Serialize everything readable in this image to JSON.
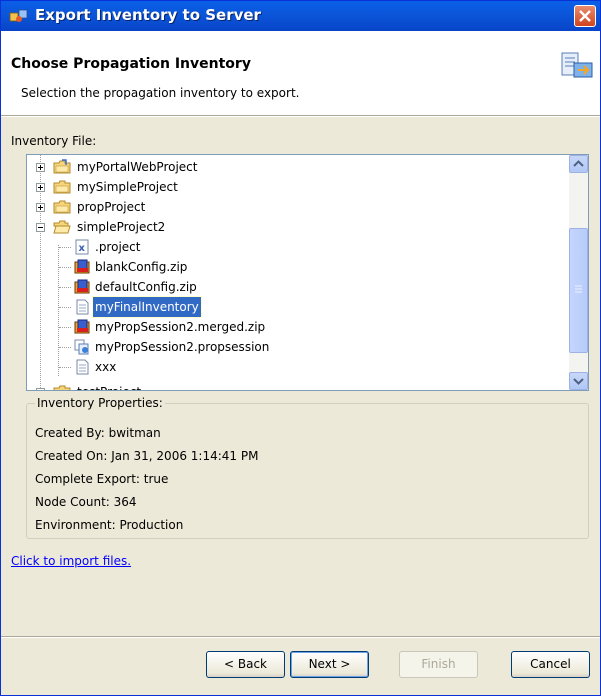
{
  "window": {
    "title": "Export Inventory to Server"
  },
  "header": {
    "title": "Choose Propagation Inventory",
    "description": "Selection the propagation inventory to export."
  },
  "inventory_label": "Inventory File:",
  "tree": {
    "items": [
      {
        "label": "myPortalWebProject",
        "icon": "project-folder-icon",
        "expander": "plus"
      },
      {
        "label": "mySimpleProject",
        "icon": "project-folder-icon",
        "expander": "plus"
      },
      {
        "label": "propProject",
        "icon": "project-folder-icon",
        "expander": "plus"
      },
      {
        "label": "simpleProject2",
        "icon": "open-project-folder-icon",
        "expander": "minus"
      },
      {
        "label": ".project",
        "icon": "xml-file-icon"
      },
      {
        "label": "blankConfig.zip",
        "icon": "zip-archive-icon"
      },
      {
        "label": "defaultConfig.zip",
        "icon": "zip-archive-icon"
      },
      {
        "label": "myFinalInventory",
        "icon": "document-icon",
        "selected": true
      },
      {
        "label": "myPropSession2.merged.zip",
        "icon": "zip-archive-icon"
      },
      {
        "label": "myPropSession2.propsession",
        "icon": "propsession-file-icon"
      },
      {
        "label": "xxx",
        "icon": "document-icon"
      },
      {
        "label": "testProject",
        "icon": "project-folder-icon",
        "expander": "plus"
      }
    ]
  },
  "properties": {
    "legend": "Inventory Properties:",
    "created_by": "Created By: bwitman",
    "created_on": "Created On: Jan 31, 2006 1:14:41 PM",
    "complete_export": "Complete Export: true",
    "node_count": "Node Count: 364",
    "environment": "Environment: Production"
  },
  "import_link": "Click to import files.",
  "buttons": {
    "back": "< Back",
    "next": "Next >",
    "finish": "Finish",
    "cancel": "Cancel"
  },
  "colors": {
    "title_bar": "#0b54d8",
    "selection": "#316ac5",
    "dialog_bg": "#ece9d8",
    "link": "#0000ff"
  }
}
